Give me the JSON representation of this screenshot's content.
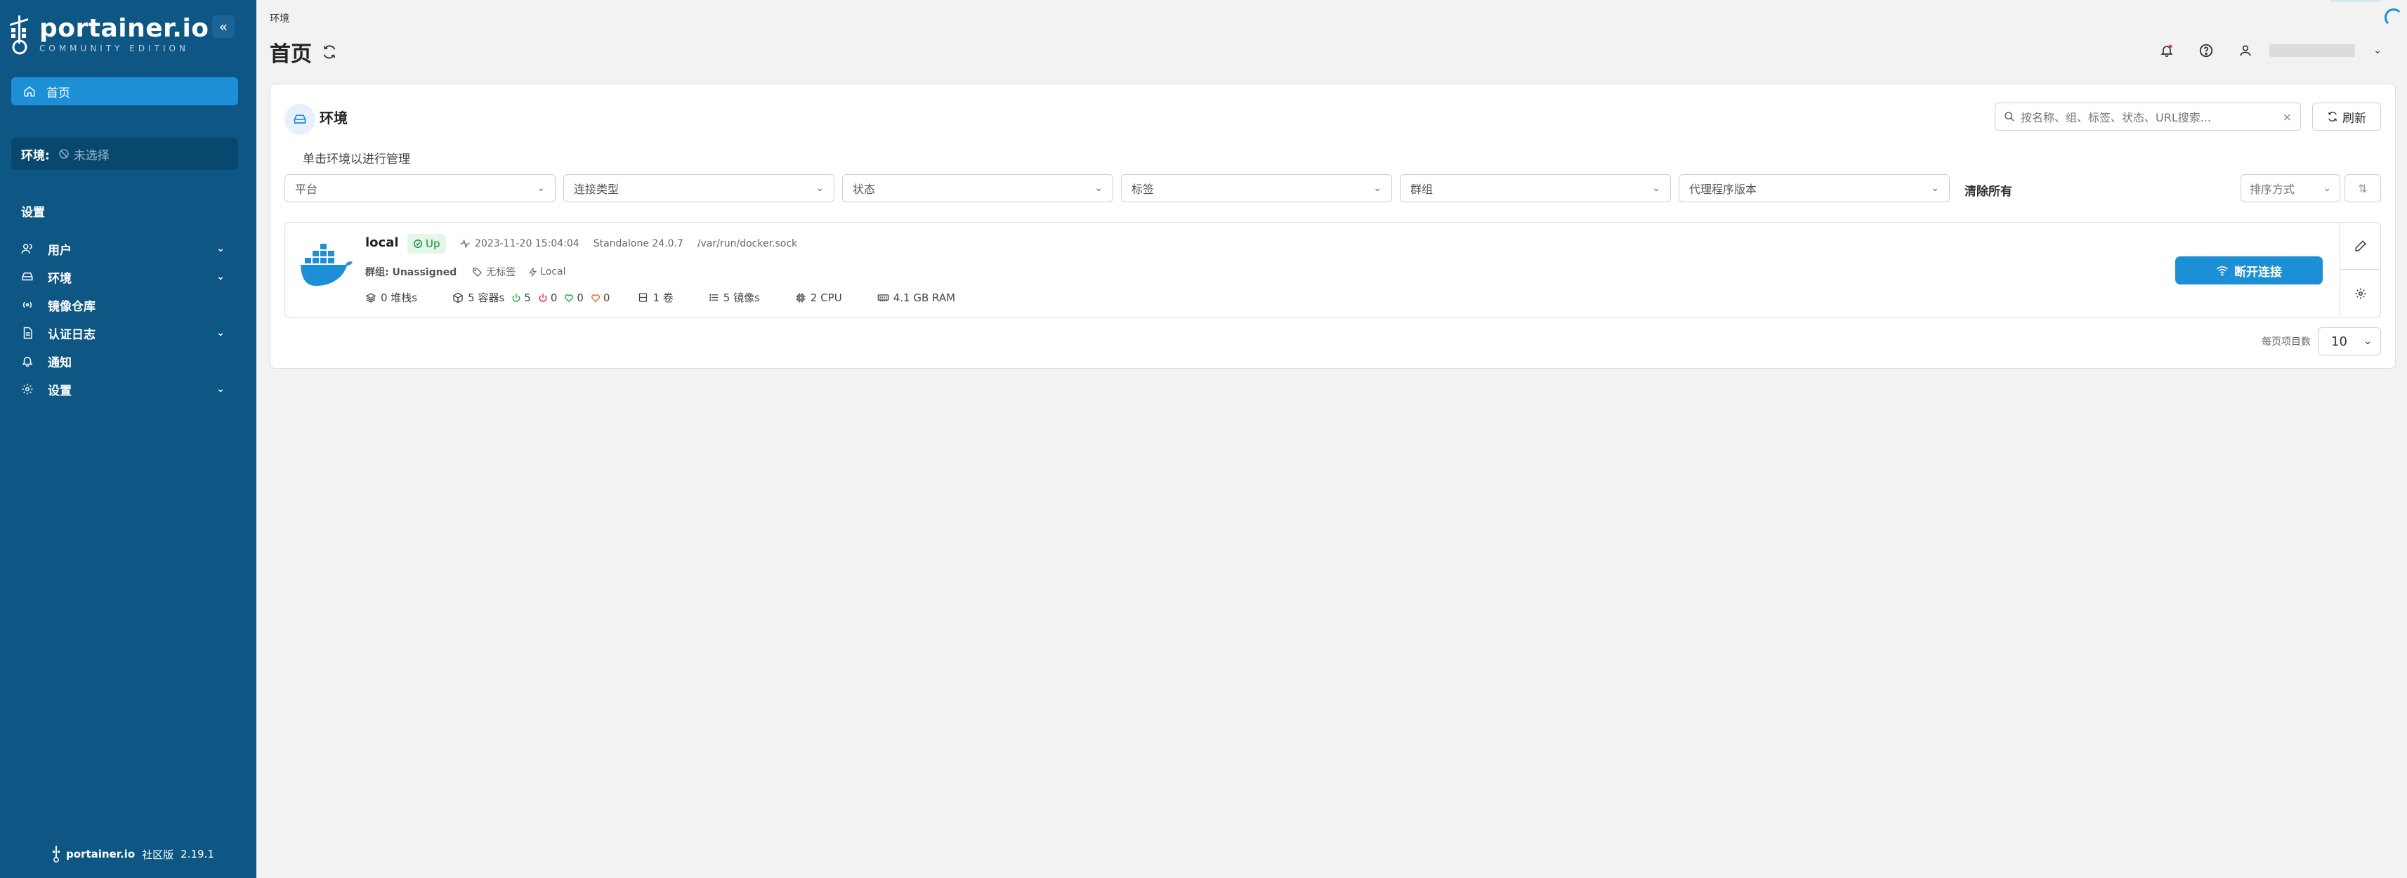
{
  "sidebar": {
    "logo": {
      "name": "portainer.io",
      "edition": "COMMUNITY EDITION"
    },
    "collapse_glyph": "«",
    "home_label": "首页",
    "env_label": "环境:",
    "env_value": "未选择",
    "settings_heading": "设置",
    "items": [
      {
        "label": "用户",
        "icon": "users-icon",
        "has_chevron": true
      },
      {
        "label": "环境",
        "icon": "environment-icon",
        "has_chevron": true
      },
      {
        "label": "镜像仓库",
        "icon": "registry-icon",
        "has_chevron": false
      },
      {
        "label": "认证日志",
        "icon": "log-icon",
        "has_chevron": true
      },
      {
        "label": "通知",
        "icon": "bell-icon",
        "has_chevron": false
      },
      {
        "label": "设置",
        "icon": "gear-icon",
        "has_chevron": true
      }
    ],
    "footer": {
      "brand": "portainer.io",
      "edition": "社区版",
      "version": "2.19.1"
    }
  },
  "header": {
    "breadcrumb": "环境",
    "title": "首页"
  },
  "panel": {
    "title": "环境",
    "hint": "单击环境以进行管理",
    "search_placeholder": "按名称、组、标签、状态、URL搜索...",
    "refresh_label": "刷新",
    "filters": [
      "平台",
      "连接类型",
      "状态",
      "标签",
      "群组",
      "代理程序版本"
    ],
    "clear_all": "清除所有",
    "sort_placeholder": "排序方式",
    "per_page_label": "每页项目数",
    "per_page_value": "10"
  },
  "environment": {
    "name": "local",
    "status": "Up",
    "timestamp": "2023-11-20 15:04:04",
    "type": "Standalone 24.0.7",
    "url": "/var/run/docker.sock",
    "group": "群组: Unassigned",
    "tags": "无标签",
    "location": "Local",
    "stacks": "0 堆栈s",
    "containers": "5 容器s",
    "running": "5",
    "stopped": "0",
    "healthy": "0",
    "unhealthy": "0",
    "volumes": "1 卷",
    "images": "5 镜像s",
    "cpu": "2 CPU",
    "ram": "4.1 GB RAM",
    "connect_label": "断开连接"
  },
  "colors": {
    "sidebar_bg": "#0e5684",
    "accent": "#1d8fd6",
    "up_green": "#1a8a3a"
  }
}
